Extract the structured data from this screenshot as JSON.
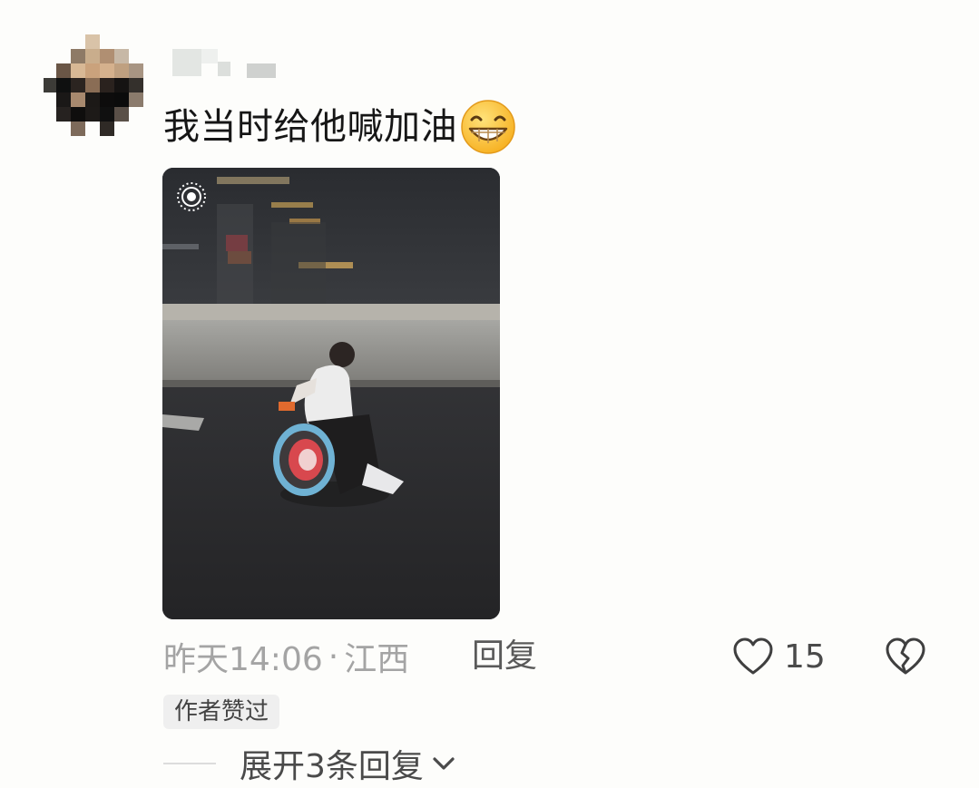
{
  "comment": {
    "text": "我当时给他喊加油",
    "emoji": "grinning-face-emoji",
    "timestamp": "昨天14:06",
    "separator": "·",
    "location": "江西",
    "reply_label": "回复",
    "like_count": "15",
    "author_badge": "作者赞过",
    "expand_replies_label": "展开3条回复"
  },
  "icons": {
    "avatar": "pixelated-avatar",
    "username": "pixelated-username",
    "live_photo": "live-photo-icon",
    "like": "heart-outline-icon",
    "dislike": "broken-heart-icon",
    "expand": "chevron-down-icon"
  },
  "colors": {
    "background": "#fdfdfb",
    "text_primary": "#161616",
    "text_secondary": "#a4a4a4",
    "badge_bg": "#efefef"
  }
}
